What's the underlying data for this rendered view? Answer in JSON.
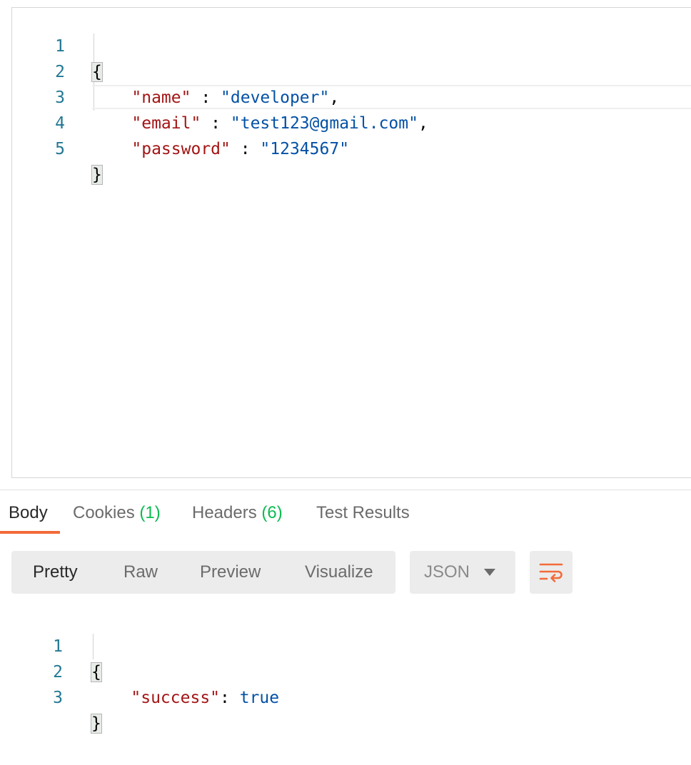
{
  "request_editor": {
    "lines": [
      {
        "no": "1",
        "indent": "",
        "open": "{"
      },
      {
        "no": "2",
        "indent": "    ",
        "key": "\"name\"",
        "sep": " : ",
        "value": "\"developer\"",
        "trail": ","
      },
      {
        "no": "3",
        "indent": "    ",
        "key": "\"email\"",
        "sep": " : ",
        "value": "\"test123@gmail.com\"",
        "trail": ","
      },
      {
        "no": "4",
        "indent": "    ",
        "key": "\"password\"",
        "sep": " : ",
        "value": "\"1234567\"",
        "trail": ""
      },
      {
        "no": "5",
        "indent": "",
        "close": "}"
      }
    ]
  },
  "response_tabs": [
    {
      "label": "Body",
      "count": ""
    },
    {
      "label": "Cookies",
      "count": "(1)"
    },
    {
      "label": "Headers",
      "count": "(6)"
    },
    {
      "label": "Test Results",
      "count": ""
    }
  ],
  "view_modes": [
    "Pretty",
    "Raw",
    "Preview",
    "Visualize"
  ],
  "format_select": {
    "value": "JSON",
    "icon": "chevron-down-icon"
  },
  "wrap_button": {
    "icon": "wrap-lines-icon"
  },
  "response_body": {
    "lines": [
      {
        "no": "1",
        "open": "{"
      },
      {
        "no": "2",
        "indent": "    ",
        "key": "\"success\"",
        "sep": ": ",
        "value": "true"
      },
      {
        "no": "3",
        "close": "}"
      }
    ]
  },
  "colors": {
    "accent": "#f26b3a",
    "count_green": "#0cbb52",
    "json_key": "#a31515",
    "json_value": "#0451a5",
    "line_number": "#237893"
  }
}
